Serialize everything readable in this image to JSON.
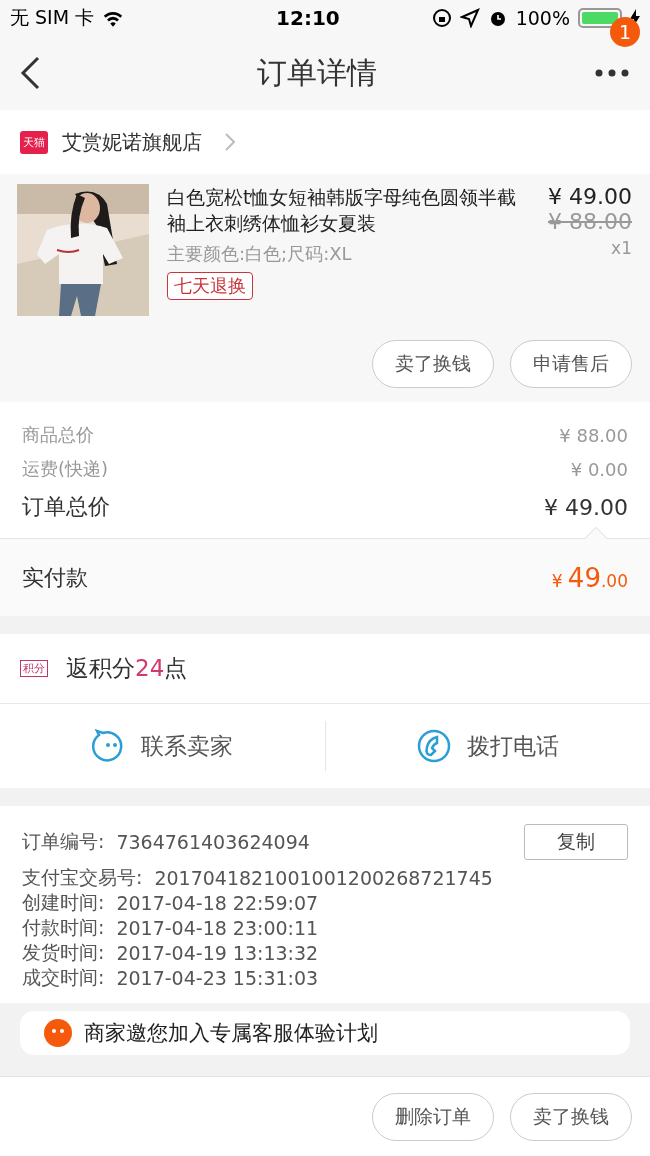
{
  "status_bar": {
    "carrier": "无 SIM 卡",
    "time": "12:10",
    "battery": "100%"
  },
  "nav": {
    "title": "订单详情",
    "badge": "1"
  },
  "store": {
    "badge": "天猫",
    "name": "艾赏妮诺旗舰店"
  },
  "item": {
    "kind": "picture",
    "title": "白色宽松t恤女短袖韩版字母纯色圆领半截袖上衣刺绣体恤衫女夏装",
    "sku": "主要颜色:白色;尺码:XL",
    "tag": "七天退换",
    "price": "¥ 49.00",
    "original_price": "¥ 88.00",
    "quantity": "x1",
    "buttons": [
      "卖了换钱",
      "申请售后"
    ]
  },
  "summary": [
    {
      "label": "商品总价",
      "value": "¥ 88.00",
      "kind": "minor"
    },
    {
      "label": "运费(快递)",
      "value": "¥ 0.00",
      "kind": "minor"
    },
    {
      "label": "订单总价",
      "value": "¥ 49.00",
      "kind": "major"
    }
  ],
  "paid": {
    "label": "实付款",
    "currency": "¥",
    "amount": "49",
    "fraction": ".00"
  },
  "points": {
    "badge": "积分",
    "prefix": "返积分",
    "value": "24",
    "suffix": "点"
  },
  "contact": [
    {
      "label": "联系卖家",
      "kind": "chat"
    },
    {
      "label": "拨打电话",
      "kind": "phone"
    }
  ],
  "order_info": [
    {
      "label": "订单编号:",
      "value": "7364761403624094",
      "copy": "复制"
    },
    {
      "label": "支付宝交易号:",
      "value": "2017041821001001200268721745"
    },
    {
      "label": "创建时间:",
      "value": "2017-04-18 22:59:07"
    },
    {
      "label": "付款时间:",
      "value": "2017-04-18 23:00:11"
    },
    {
      "label": "发货时间:",
      "value": "2017-04-19 13:13:32"
    },
    {
      "label": "成交时间:",
      "value": "2017-04-23 15:31:03"
    }
  ],
  "invite_card": {
    "title": "商家邀您加入专属客服体验计划"
  },
  "bottom_buttons": [
    "删除订单",
    "卖了换钱"
  ]
}
